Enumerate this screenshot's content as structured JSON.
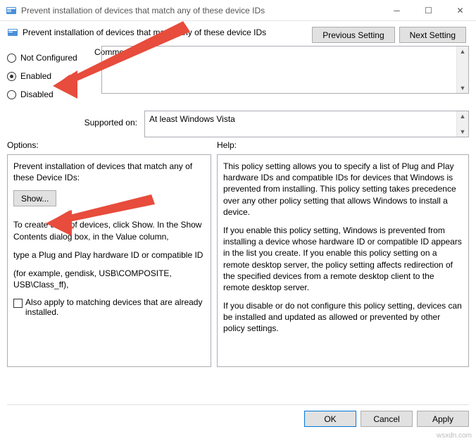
{
  "titlebar": {
    "text": "Prevent installation of devices that match any of these device IDs"
  },
  "header": {
    "title": "Prevent installation of devices that match any of these device IDs",
    "previous_setting": "Previous Setting",
    "next_setting": "Next Setting"
  },
  "radios": {
    "not_configured": "Not Configured",
    "enabled": "Enabled",
    "disabled": "Disabled"
  },
  "fields": {
    "comment_label": "Comment:",
    "supported_label": "Supported on:",
    "supported_value": "At least Windows Vista"
  },
  "section_labels": {
    "options": "Options:",
    "help": "Help:"
  },
  "options_panel": {
    "p1": "Prevent installation of devices that match any of these Device IDs:",
    "show_btn": "Show...",
    "p2": "To create a list of devices, click Show. In the Show Contents dialog box, in the Value column,",
    "p3": "type a Plug and Play hardware ID or compatible ID",
    "p4": "(for example, gendisk, USB\\COMPOSITE, USB\\Class_ff),",
    "checkbox_label": "Also apply to matching devices that are already installed."
  },
  "help_panel": {
    "p1": "This policy setting allows you to specify a list of Plug and Play hardware IDs and compatible IDs for devices that Windows is prevented from installing. This policy setting takes precedence over any other policy setting that allows Windows to install a device.",
    "p2": "If you enable this policy setting, Windows is prevented from installing a device whose hardware ID or compatible ID appears in the list you create. If you enable this policy setting on a remote desktop server, the policy setting affects redirection of the specified devices from a remote desktop client to the remote desktop server.",
    "p3": "If you disable or do not configure this policy setting, devices can be installed and updated as allowed or prevented by other policy settings."
  },
  "buttons": {
    "ok": "OK",
    "cancel": "Cancel",
    "apply": "Apply"
  },
  "watermark": "wsxdn.com"
}
